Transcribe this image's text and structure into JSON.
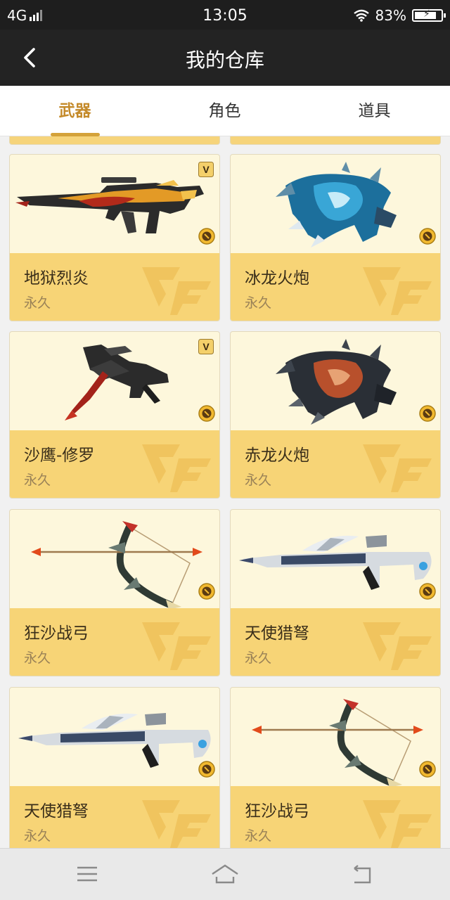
{
  "status_bar": {
    "network": "4G",
    "time": "13:05",
    "battery": "83%"
  },
  "header": {
    "title": "我的仓库"
  },
  "tabs": [
    {
      "label": "武器",
      "active": true
    },
    {
      "label": "角色",
      "active": false
    },
    {
      "label": "道具",
      "active": false
    }
  ],
  "items": [
    {
      "name": "地狱烈炎",
      "duration": "永久",
      "image": "rifle",
      "vip": true
    },
    {
      "name": "冰龙火炮",
      "duration": "永久",
      "image": "dragon-cannon-blue",
      "vip": false
    },
    {
      "name": "沙鹰-修罗",
      "duration": "永久",
      "image": "pistol",
      "vip": true
    },
    {
      "name": "赤龙火炮",
      "duration": "永久",
      "image": "dragon-cannon-red",
      "vip": false
    },
    {
      "name": "狂沙战弓",
      "duration": "永久",
      "image": "bow",
      "vip": false
    },
    {
      "name": "天使猎弩",
      "duration": "永久",
      "image": "crossbow",
      "vip": false
    },
    {
      "name": "天使猎弩",
      "duration": "永久",
      "image": "crossbow",
      "vip": false
    },
    {
      "name": "狂沙战弓",
      "duration": "永久",
      "image": "bow",
      "vip": false
    }
  ],
  "icons": {
    "vip_badge": "V",
    "watermark": "cf-logo",
    "coin": "currency-coin-icon"
  },
  "colors": {
    "accent": "#c48a2a",
    "card_bottom": "#f7d476",
    "card_top": "#fdf7dc",
    "header_bg": "#232323"
  }
}
